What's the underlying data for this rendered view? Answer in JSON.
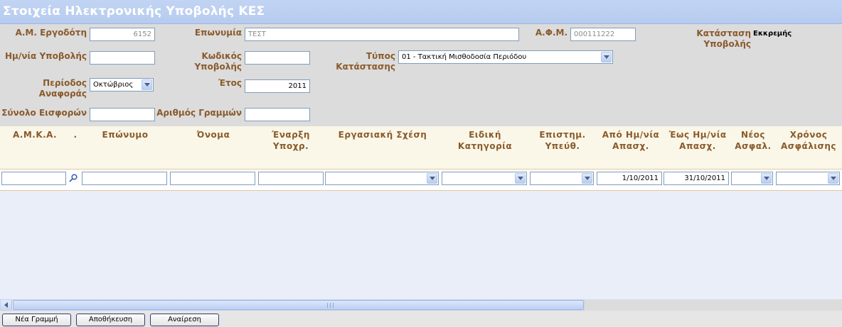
{
  "header": {
    "title": "Στοιχεία Ηλεκτρονικής Υποβολής ΚΕΣ"
  },
  "form": {
    "am_ergodoti": {
      "label": "Α.Μ. Εργοδότη",
      "value": "6152"
    },
    "eponymia": {
      "label": "Επωνυμία",
      "value": "ΤΕΣΤ"
    },
    "afm": {
      "label": "Α.Φ.Μ.",
      "value": "000111222"
    },
    "katastasi_ypovolis": {
      "label": "Κατάσταση Υποβολής",
      "value": "Εκκρεμής"
    },
    "hmnia_ypovolis": {
      "label": "Ημ/νία Υποβολής",
      "value": ""
    },
    "kodikos_ypovolis": {
      "label_line1": "Κωδικός",
      "label_line2": "Υποβολής",
      "value": ""
    },
    "typos_katastasis": {
      "label_line1": "Τύπος",
      "label_line2": "Κατάστασης",
      "value": "01 - Τακτική Μισθοδοσία Περιόδου"
    },
    "periodos_anaforas": {
      "label_line1": "Περίοδος",
      "label_line2": "Αναφοράς",
      "value": "Οκτώβριος"
    },
    "etos": {
      "label": "Έτος",
      "value": "2011"
    },
    "synolo_eisforon": {
      "label": "Σύνολο Εισφορών",
      "value": ""
    },
    "arithmos_grammon": {
      "label": "Αριθμός Γραμμών",
      "value": ""
    }
  },
  "grid": {
    "columns": [
      {
        "line1": "Α.Μ.Κ.Α.",
        "line2": ""
      },
      {
        "line1": ".",
        "line2": ""
      },
      {
        "line1": "Επώνυμο",
        "line2": ""
      },
      {
        "line1": "Όνομα",
        "line2": ""
      },
      {
        "line1": "Έναρξη",
        "line2": "Υποχρ."
      },
      {
        "line1": "Εργασιακή Σχέση",
        "line2": ""
      },
      {
        "line1": "Ειδική",
        "line2": "Κατηγορία"
      },
      {
        "line1": "Επιστημ.",
        "line2": "Υπεύθ."
      },
      {
        "line1": "Από Ημ/νία",
        "line2": "Απασχ."
      },
      {
        "line1": "Έως Ημ/νία",
        "line2": "Απασχ."
      },
      {
        "line1": "Νέος",
        "line2": "Ασφαλ."
      },
      {
        "line1": "Χρόνος",
        "line2": "Ασφάλισης"
      }
    ],
    "row": {
      "amka": "",
      "eponymo": "",
      "onoma": "",
      "enarxi": "",
      "ergasiaki_sxesi": "",
      "eidiki_katigoria": "",
      "epistim": "",
      "apo_hmnia": "1/10/2011",
      "eos_hmnia": "31/10/2011",
      "neos_asfal": "",
      "xronos_asfalisis": ""
    }
  },
  "buttons": {
    "new_row": "Νέα Γραμμή",
    "save": "Αποθήκευση",
    "undo": "Αναίρεση"
  },
  "colors": {
    "title_bar": "#b6cbef",
    "label_brown": "#8a5a2b",
    "grid_header_bg": "#faf7e8",
    "grid_body_bg": "#eaeef8"
  }
}
